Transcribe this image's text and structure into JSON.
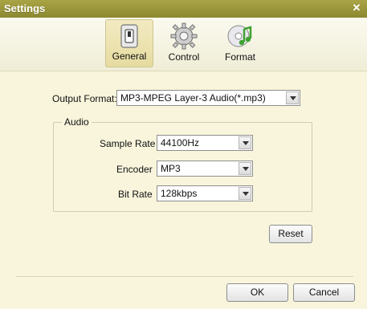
{
  "window": {
    "title": "Settings",
    "close_label": "✕"
  },
  "toolbar": {
    "tabs": [
      {
        "label": "General",
        "icon": "switch-icon",
        "active": true
      },
      {
        "label": "Control",
        "icon": "gear-icon",
        "active": false
      },
      {
        "label": "Format",
        "icon": "disc-music-icon",
        "active": false
      }
    ]
  },
  "output_format": {
    "label": "Output Format:",
    "value": "MP3-MPEG Layer-3 Audio(*.mp3)"
  },
  "audio": {
    "legend": "Audio",
    "sample_rate": {
      "label": "Sample Rate",
      "value": "44100Hz"
    },
    "encoder": {
      "label": "Encoder",
      "value": "MP3"
    },
    "bit_rate": {
      "label": "Bit Rate",
      "value": "128kbps"
    }
  },
  "buttons": {
    "reset": "Reset",
    "ok": "OK",
    "cancel": "Cancel"
  },
  "colors": {
    "titlebar": "#9b9738",
    "background": "#f8f5dc"
  }
}
